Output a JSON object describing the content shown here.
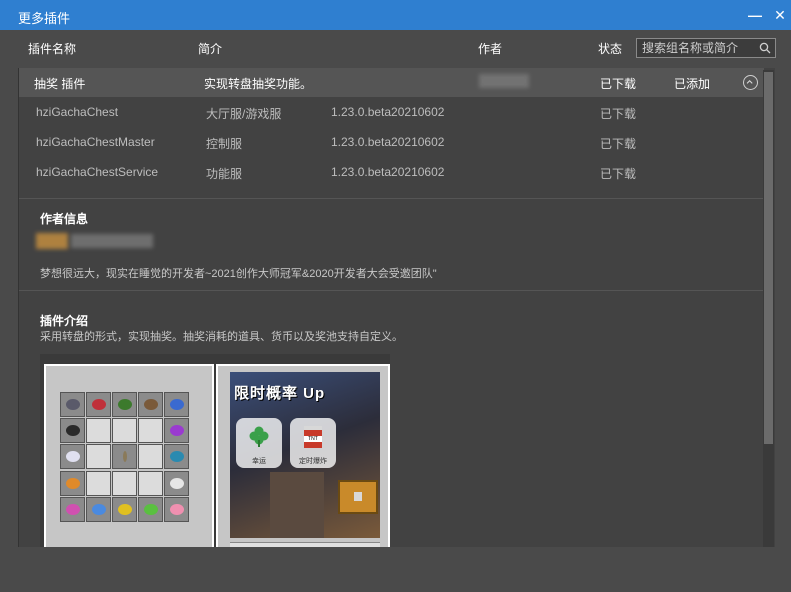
{
  "window": {
    "title": "更多插件",
    "minimize_label": "—",
    "close_label": "✕"
  },
  "columns": {
    "name": "插件名称",
    "desc": "简介",
    "author": "作者",
    "status": "状态"
  },
  "search": {
    "placeholder": "搜索组名称或简介"
  },
  "plugin": {
    "name": "抽奖 插件",
    "desc": "实现转盘抽奖功能。",
    "status": "已下载",
    "action": "已添加",
    "subitems": [
      {
        "name": "hziGachaChest",
        "type": "大厅服/游戏服",
        "version": "1.23.0.beta20210602",
        "status": "已下载"
      },
      {
        "name": "hziGachaChestMaster",
        "type": "控制服",
        "version": "1.23.0.beta20210602",
        "status": "已下载"
      },
      {
        "name": "hziGachaChestService",
        "type": "功能服",
        "version": "1.23.0.beta20210602",
        "status": "已下载"
      }
    ]
  },
  "author_info": {
    "title": "作者信息",
    "bio": "梦想很远大，现实在睡觉的开发者~2021创作大师冠军&2020开发者大会受邀团队\""
  },
  "intro": {
    "title": "插件介绍",
    "text": "采用转盘的形式，实现抽奖。抽奖消耗的道具、货币以及奖池支持自定义。",
    "poster_title": "限时概率 Up",
    "card_left_label": "幸运",
    "card_right_label": "定时爆炸",
    "tnt_label": "TNT"
  },
  "colors": {
    "titlebar": "#2f7fd0",
    "background": "#4a4a4a",
    "panel": "#424242"
  }
}
